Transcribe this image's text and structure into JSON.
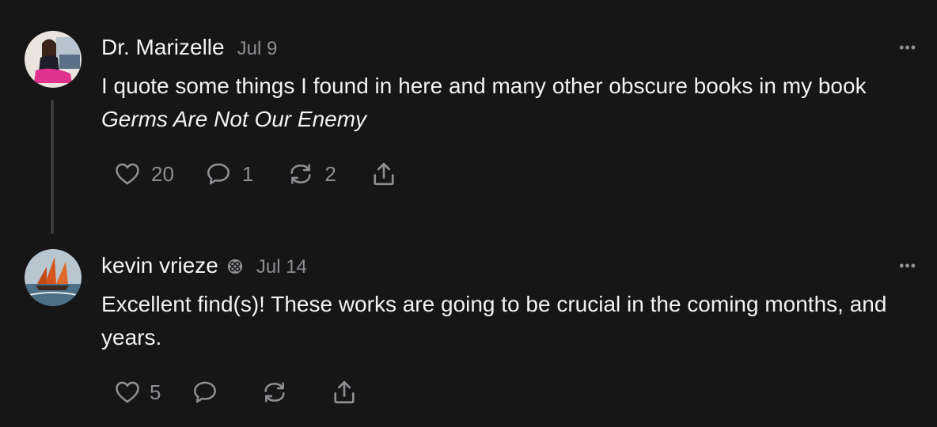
{
  "comments": [
    {
      "author": "Dr. Marizelle",
      "date": "Jul 9",
      "body_prefix": "I quote some things I found in here and many other obscure books in my book ",
      "body_italic": "Germs Are Not Our Enemy",
      "likes": "20",
      "replies": "1",
      "restacks": "2",
      "more_label": "•••"
    },
    {
      "author": "kevin vrieze",
      "date": "Jul 14",
      "body": "Excellent find(s)! These works are going to be crucial in the coming months, and years.",
      "likes": "5",
      "more_label": "•••"
    }
  ],
  "colors": {
    "background": "#161617",
    "text": "#f2f2f2",
    "muted": "#8e8e93",
    "thread_line": "#3a3a3c"
  },
  "icons": [
    "heart-icon",
    "comment-icon",
    "restack-icon",
    "share-icon",
    "verified-badge-icon",
    "more-icon"
  ]
}
